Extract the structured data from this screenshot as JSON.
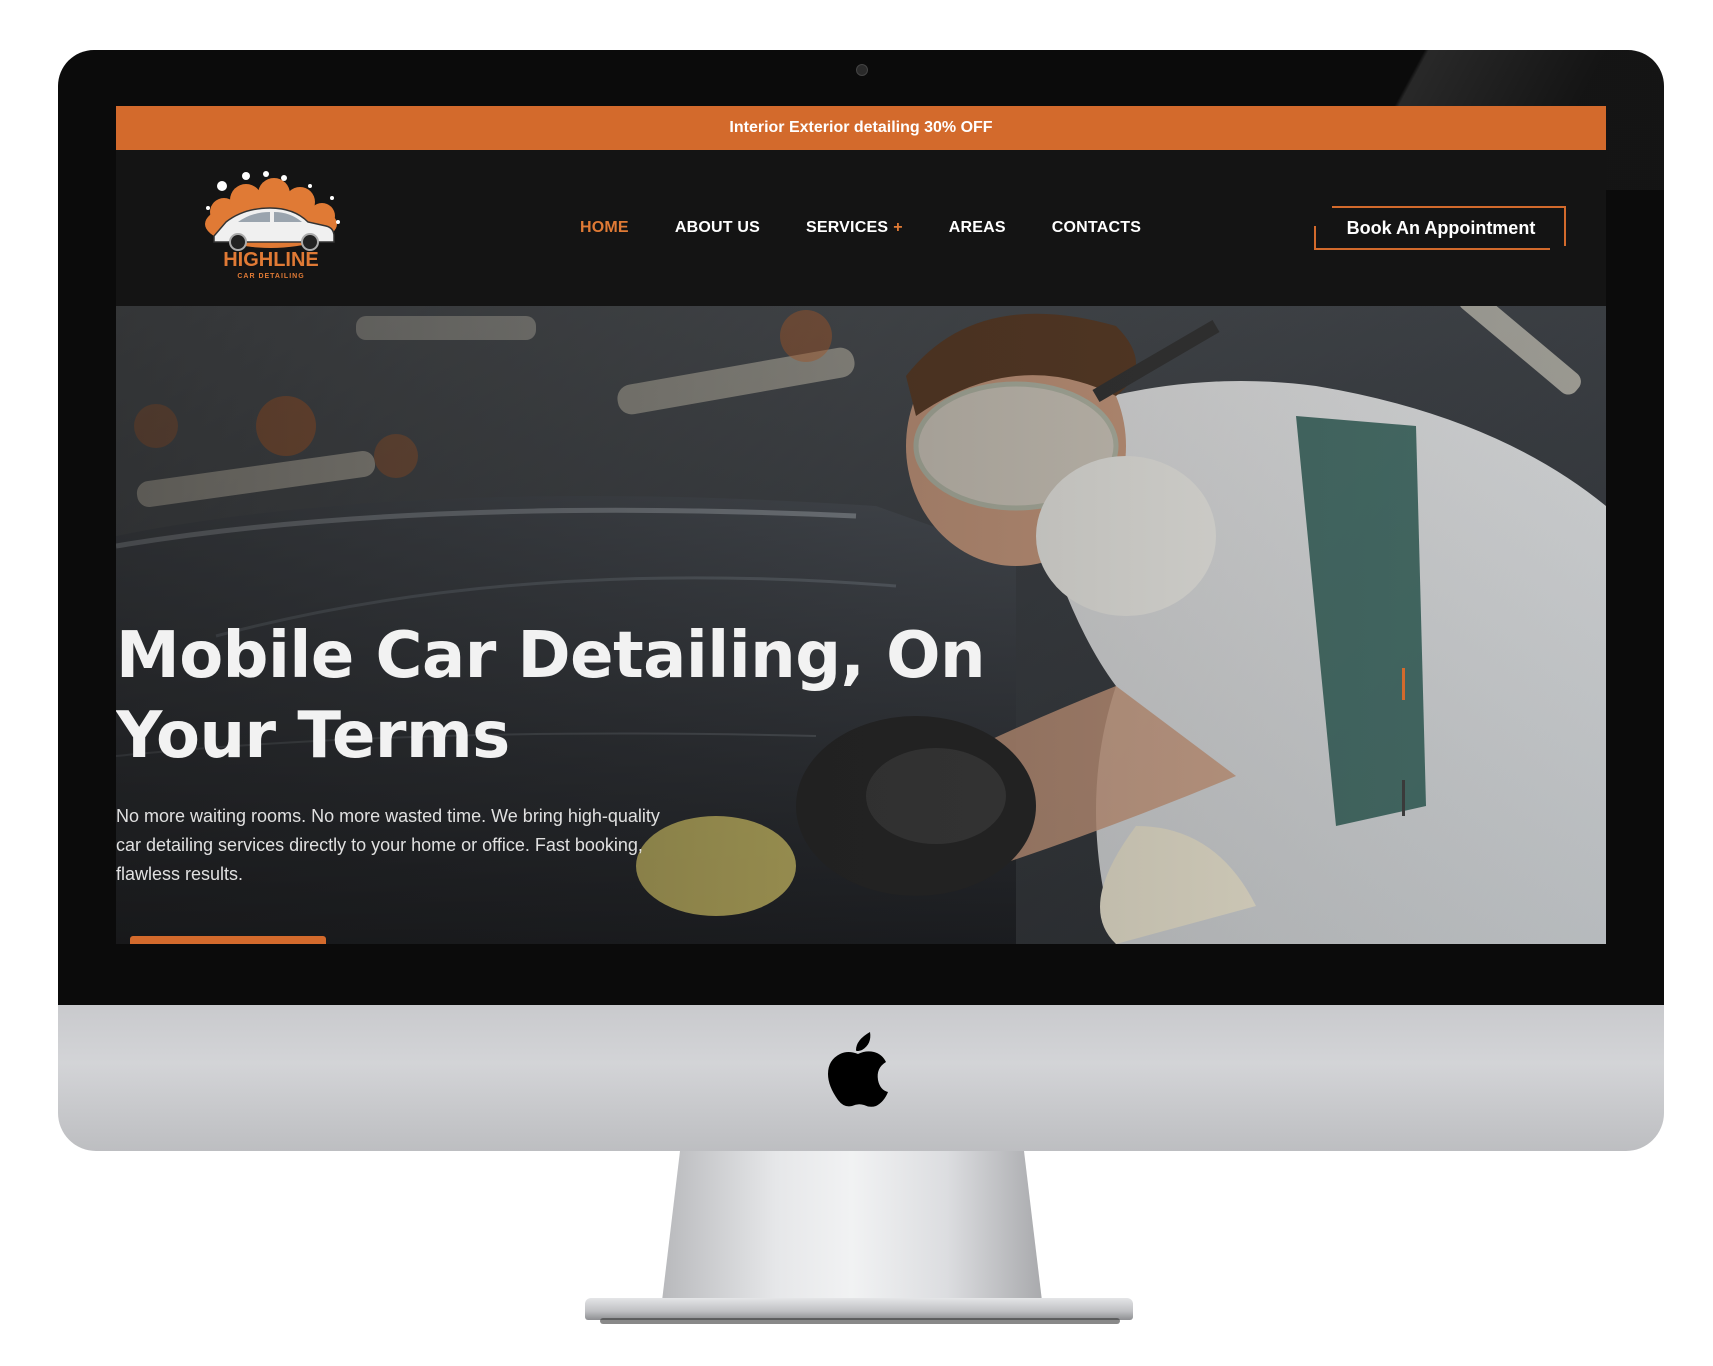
{
  "promo": {
    "text": "Interior Exterior detailing 30% OFF"
  },
  "brand": {
    "name": "HIGHLINE",
    "tagline": "CAR DETAILING"
  },
  "nav": {
    "items": [
      {
        "label": "HOME",
        "active": true
      },
      {
        "label": "ABOUT US",
        "active": false
      },
      {
        "label": "SERVICES",
        "active": false,
        "has_submenu": true,
        "submenu_indicator": "+"
      },
      {
        "label": "AREAS",
        "active": false
      },
      {
        "label": "CONTACTS",
        "active": false
      }
    ],
    "cta_label": "Book An Appointment"
  },
  "hero": {
    "title": "Mobile Car Detailing, On Your Terms",
    "subtitle": "No more waiting rooms. No more wasted time. We bring high-quality car detailing services directly to your home or office. Fast booking, flawless results."
  },
  "colors": {
    "accent": "#d36a2c",
    "nav_bg": "#141414",
    "active_link": "#e07a35"
  },
  "icons": {
    "device": "imac-frame",
    "brand_mark": "apple-logo-icon",
    "logo": "car-bubbles-logo"
  }
}
